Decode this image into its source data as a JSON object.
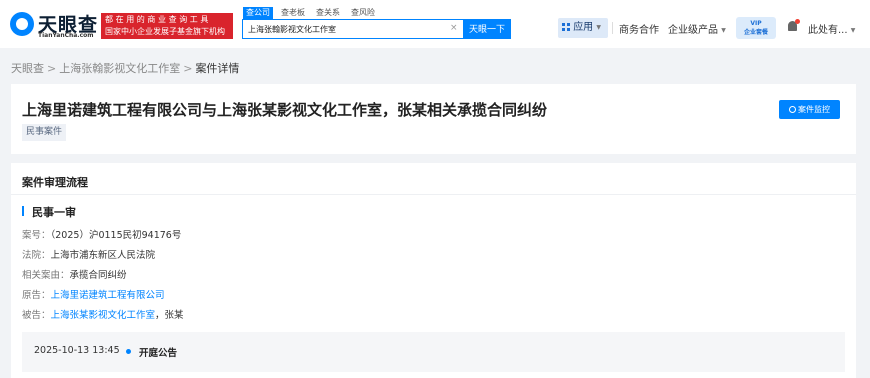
{
  "header": {
    "logo_text": "天眼查",
    "logo_sub": "TianYanCha.com",
    "slogan_line1": "都在用的商业查询工具",
    "slogan_line2": "国家中小企业发展子基金旗下机构",
    "search_tabs": [
      "查公司",
      "查老板",
      "查关系",
      "查风险"
    ],
    "search_value": "上海张翰影视文化工作室",
    "search_clear": "×",
    "search_button": "天眼一下",
    "apps_label": "应用",
    "nav_business": "商务合作",
    "nav_enterprise": "企业级产品",
    "vip_line1": "VIP",
    "vip_line2": "企业套餐",
    "user_label": "此处有..."
  },
  "breadcrumb": {
    "home": "天眼查",
    "company": "上海张翰影视文化工作室",
    "current": "案件详情",
    "separator": ">"
  },
  "case": {
    "title": "上海里诺建筑工程有限公司与上海张某影视文化工作室，张某相关承揽合同纠纷",
    "tag": "民事案件",
    "monitor_button": "案件监控"
  },
  "process": {
    "section_title": "案件审理流程",
    "stage_title": "民事一审",
    "case_no_key": "案号：",
    "case_no": "（2025）沪0115民初94176号",
    "court_key": "法院：",
    "court": "上海市浦东新区人民法院",
    "cause_key": "相关案由：",
    "cause": "承揽合同纠纷",
    "plaintiff_key": "原告：",
    "plaintiff": "上海里诺建筑工程有限公司",
    "defendant_key": "被告：",
    "defendant_company": "上海张某影视文化工作室",
    "defendant_sep": "，",
    "defendant_person": "张某",
    "timeline_date": "2025-10-13 13:45",
    "timeline_event": "开庭公告"
  },
  "colors": {
    "brand_blue": "#0084ff",
    "slogan_red": "#d9242c",
    "page_bg": "#f1f3f6"
  }
}
